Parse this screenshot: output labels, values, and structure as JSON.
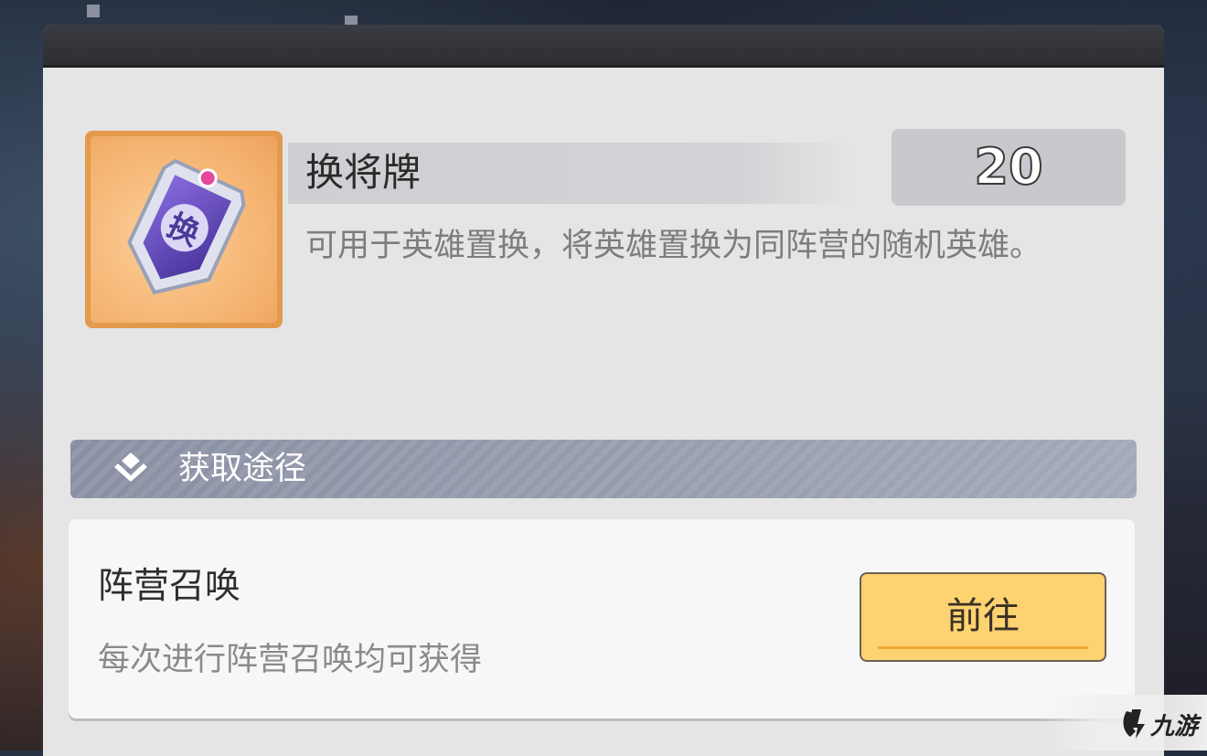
{
  "item": {
    "name": "换将牌",
    "count": "20",
    "description": "可用于英雄置换，将英雄置换为同阵营的随机英雄。",
    "icon_glyph": "换",
    "icon": "hero-swap-card-icon"
  },
  "acquire_section": {
    "title": "获取途径",
    "icon": "diamond-chevron-icon"
  },
  "sources": [
    {
      "title": "阵营召唤",
      "description": "每次进行阵营召唤均可获得",
      "button_label": "前往"
    }
  ],
  "watermark": {
    "text": "九游",
    "icon": "jiuyou-logo-icon"
  },
  "colors": {
    "panel_bg": "#e5e5e5",
    "icon_frame": "#e39a4c",
    "section_header": "#959bad",
    "button_fill": "#fdd271"
  }
}
